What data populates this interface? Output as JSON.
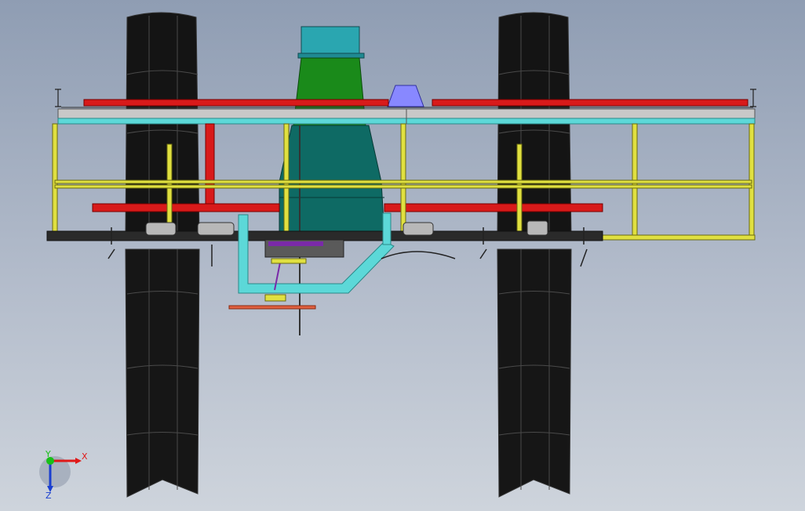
{
  "view": {
    "background_top": "#8f9db3",
    "background_bottom": "#ced4dc"
  },
  "triad": {
    "x_label": "X",
    "y_label": "Y",
    "z_label": "Z",
    "x_color": "#e01818",
    "y_color": "#18c018",
    "z_color": "#1a3fd0"
  },
  "colors": {
    "tire": "#161616",
    "frame_yellow": "#e0e040",
    "red_beam": "#d81a1a",
    "cyan": "#5cd8d8",
    "hopper_top": "#2aa6b0",
    "hopper_green": "#1a8a1a",
    "hopper_teal": "#0e6a64",
    "purple": "#7a2aa8",
    "blue_block": "#8888ff",
    "grey_plate": "#c8c8c8"
  }
}
